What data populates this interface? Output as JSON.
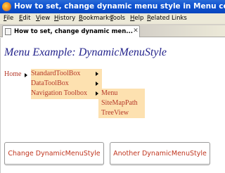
{
  "window": {
    "title": "How to set, change dynamic menu style in Menu control programmatically"
  },
  "menubar": {
    "items": [
      "File",
      "Edit",
      "View",
      "History",
      "Bookmarks",
      "Tools",
      "Help",
      "Related Links"
    ]
  },
  "tab": {
    "label": "How to set, change dynamic men..."
  },
  "page": {
    "title": "Menu Example: DynamicMenuStyle",
    "menu": {
      "root": "Home",
      "level1": [
        "StandardToolBox",
        "DataToolBox",
        "Navigation Toolbox"
      ],
      "level2": [
        "Menu",
        "SiteMapPath",
        "TreeView"
      ]
    },
    "buttons": {
      "change": "Change DynamicMenuStyle",
      "another": "Another DynamicMenuStyle"
    }
  },
  "colors": {
    "title_blue": "#24248c",
    "menu_text": "#b53a2a",
    "menu_bg": "#fde1b0",
    "titlebar_blue": "#0d52d0"
  }
}
